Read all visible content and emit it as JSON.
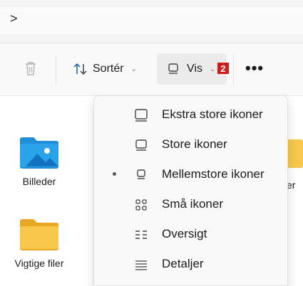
{
  "address": {
    "chevron": ">"
  },
  "toolbar": {
    "sort_label": "Sortér",
    "view_label": "Vis",
    "view_badge": "2",
    "more_label": "•••"
  },
  "files": [
    {
      "label": "Billeder",
      "icon": "pictures-folder-icon"
    },
    {
      "label": "Vigtige filer",
      "icon": "folder-icon"
    }
  ],
  "peek_label": "er",
  "view_menu": {
    "items": [
      {
        "label": "Ekstra store ikoner",
        "icon": "extra-large-icons-icon",
        "selected": false
      },
      {
        "label": "Store ikoner",
        "icon": "large-icons-icon",
        "selected": false
      },
      {
        "label": "Mellemstore ikoner",
        "icon": "medium-icons-icon",
        "selected": true
      },
      {
        "label": "Små ikoner",
        "icon": "small-icons-icon",
        "selected": false
      },
      {
        "label": "Oversigt",
        "icon": "list-icon",
        "selected": false
      },
      {
        "label": "Detaljer",
        "icon": "details-icon",
        "selected": false
      }
    ]
  },
  "colors": {
    "badge": "#d11b1b",
    "folder": "#f7c84c",
    "pictures_folder": "#1e8fd6"
  }
}
